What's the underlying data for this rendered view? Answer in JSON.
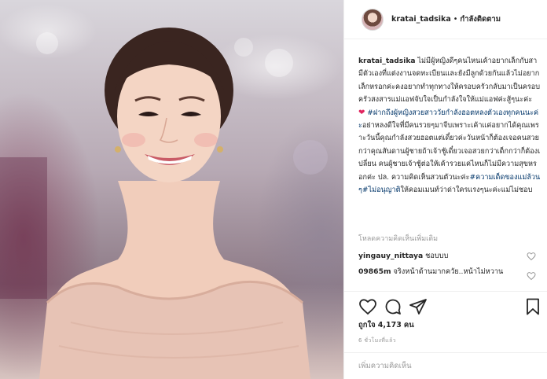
{
  "post": {
    "photo_icon": "portrait-photo",
    "header": {
      "username": "kratai_tadsika",
      "separator": "•",
      "follow_status": "กำลังติดตาม"
    },
    "caption": {
      "username": "kratai_tadsika",
      "text_1": " ไม่มีผู้หญิงดีๆคนไหนเค้าอยากเล็กกับสามีตัวเองที่แต่งงานจดทะเบียนและยังมีลูกด้วยกันแล้วไม่อยากเล็กหรอกค่ะคงอยากทำทุกทางให้ครอบครัวกลับมาเป็นครอบครัวสงสารแม่แอฟจับใจเป็นกำลังใจให้แม่แอฟค่ะสู้ๆนะค่ะ ",
      "heart": "❤",
      "tag_1": " #ฝากถึงผู้หญิงสวยสาววัยกำลังฮอตหลงตัวเองทุกคนนะค่ะ",
      "text_2": "อย่าหลงดีใจที่มีคนรวยๆมาจีบเพราะเค้าแค่อยากได้คุณเพราะวันนี้คุณกำลังสวยฮอตแต่เดี๋ยวค่ะวันหน้าก็ต้องเจอคนสวยกว่าคุณสันดานผู้ชายถ้าเจ้าชู้เดี๋ยวเจอสวยกว่าเด็กกว่าก็ต้องเปลี่ยน คนผู้ชายเจ้าชู้ต่อให้เค้ารวยแค่ไหนก็ไม่มีความสุขหรอกค่ะ ปล. ความคิดเห็นสวนตัวนะค่ะ",
      "tag_2": "#ความเด็ดของแม่ล้วนๆ#ไม่อนุญาติ",
      "text_3": "ให้คอมเมนท์ว่าด่าใครแรงๆนะค่ะแม่ไม่ชอบ"
    },
    "load_more": "โหลดความคิดเห็นเพิ่มเติม",
    "comments": [
      {
        "username": "yingauy_nittaya",
        "text": " ชอบบบ"
      },
      {
        "username": "09865m",
        "text": " จริงหน้าด้านมากควัย..หน้าไม่หวาน"
      }
    ],
    "likes_label": "ถูกใจ",
    "likes_count": "4,173",
    "likes_unit": "คน",
    "timestamp": "6 ชั่วโมงที่แล้ว",
    "add_comment_placeholder": "เพิ่มความคิดเห็น",
    "icons": [
      "heart-icon",
      "comment-icon",
      "share-icon",
      "bookmark-icon"
    ]
  }
}
